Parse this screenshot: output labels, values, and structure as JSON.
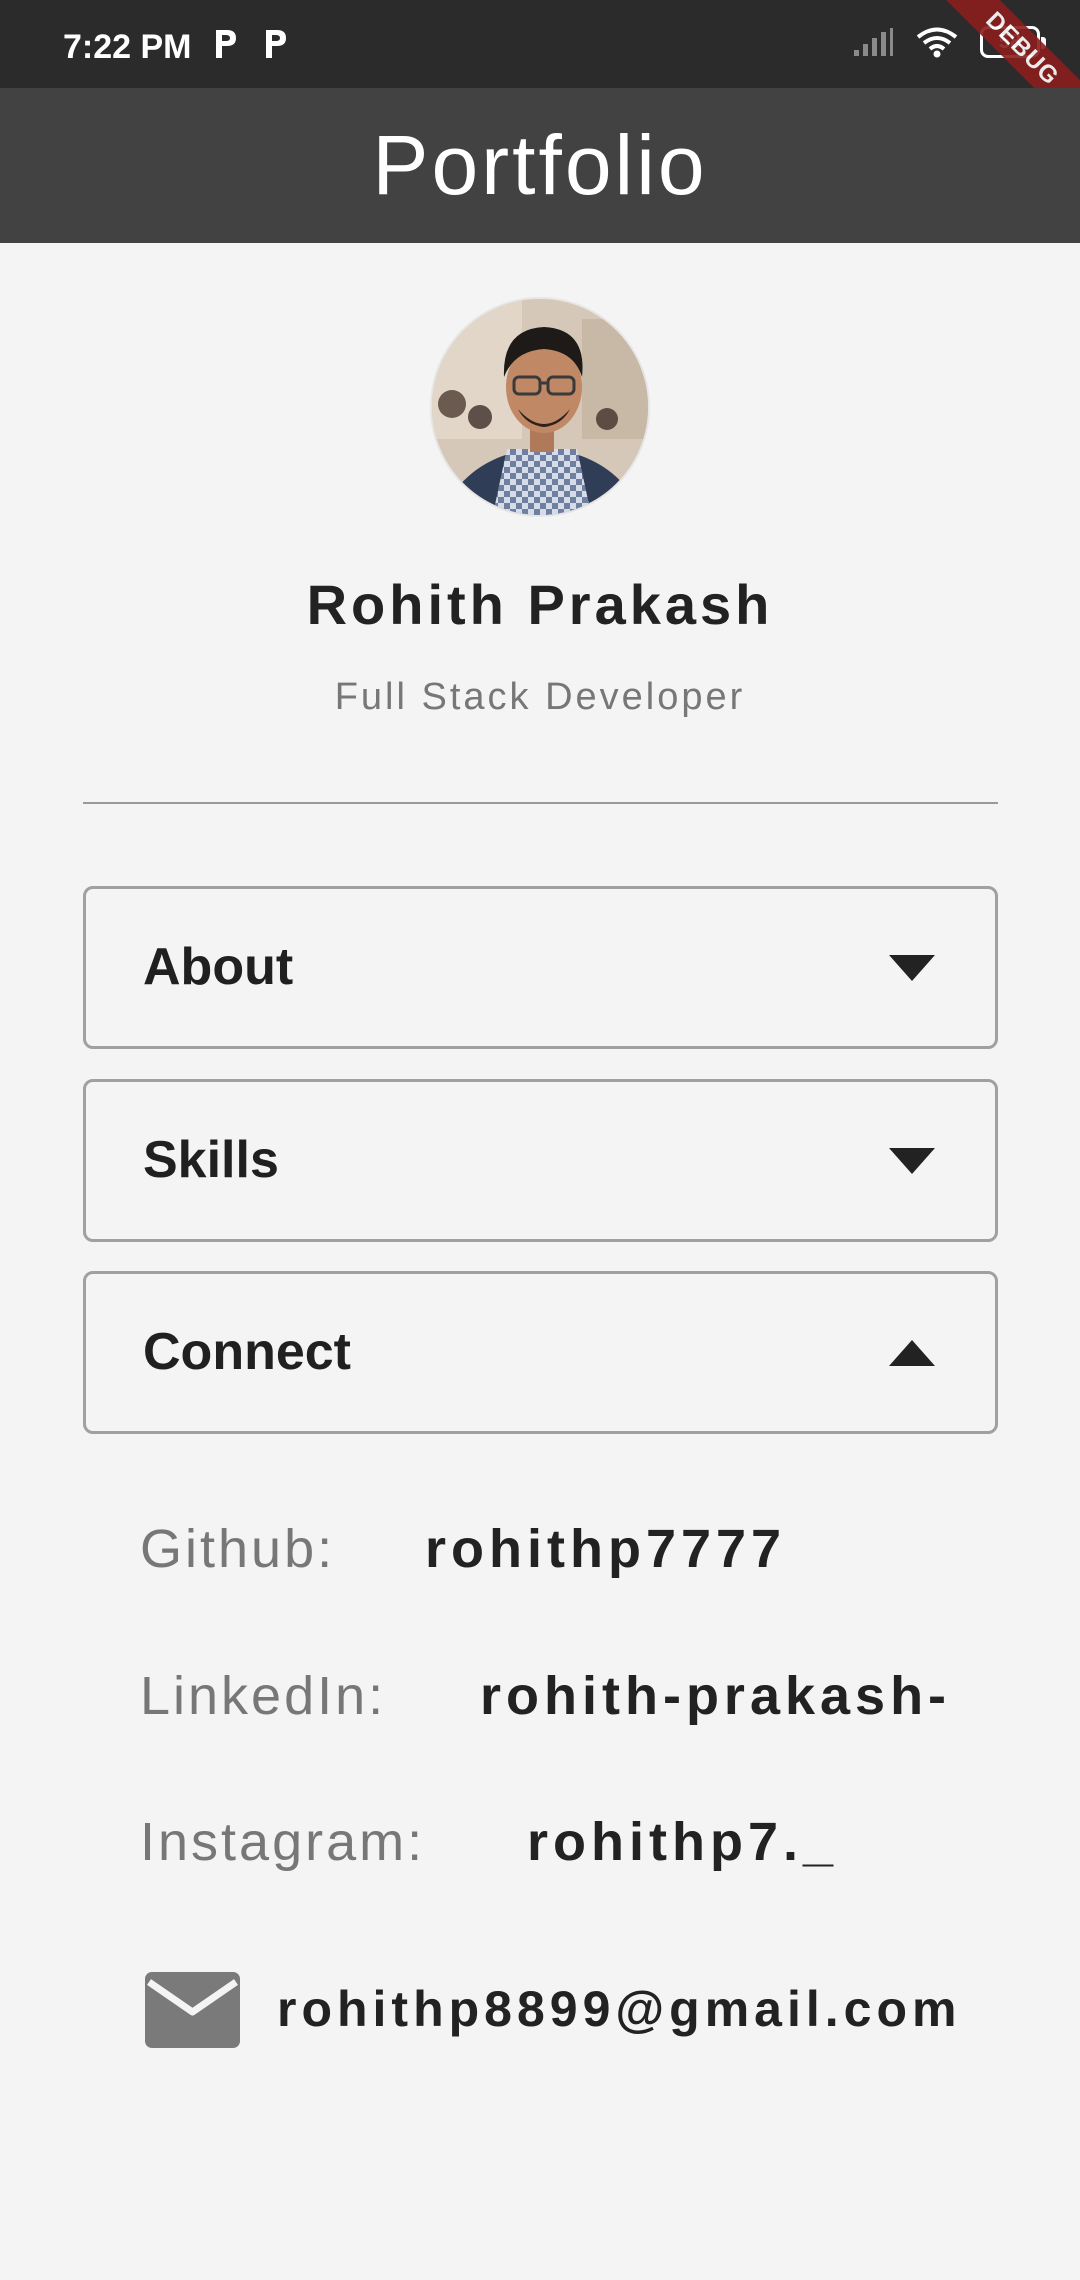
{
  "status_bar": {
    "time": "7:22 PM",
    "notification_icons": [
      "parking-icon",
      "parking-icon"
    ],
    "battery_level": "58",
    "debug_banner": "DEBUG"
  },
  "app_bar": {
    "title": "Portfolio"
  },
  "profile": {
    "name": "Rohith Prakash",
    "role": "Full Stack Developer"
  },
  "sections": [
    {
      "label": "About",
      "expanded": false
    },
    {
      "label": "Skills",
      "expanded": false
    },
    {
      "label": "Connect",
      "expanded": true
    }
  ],
  "connect": {
    "github_label": "Github:",
    "github_value": "rohithp7777",
    "linkedin_label": "LinkedIn:",
    "linkedin_value": "rohith-prakash-",
    "instagram_label": "Instagram:",
    "instagram_value": "rohithp7._",
    "email": "rohithp8899@gmail.com"
  },
  "colors": {
    "status_bar": "#2b2b2b",
    "app_bar": "#424242",
    "background": "#f4f4f4",
    "debug_ribbon": "#8b1d1d"
  }
}
